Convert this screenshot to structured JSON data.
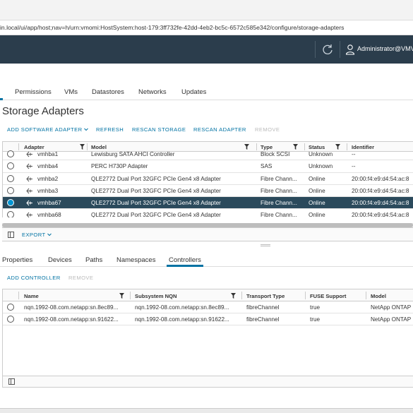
{
  "browser": {
    "url": "in.local/ui/app/host;nav=h/urn:vmomi:HostSystem:host-179:3ff732fe-42dd-4eb2-bc5c-6572c585e342/configure/storage-adapters"
  },
  "header": {
    "user": "Administrator@VMV"
  },
  "subnav": {
    "tabs": [
      "Permissions",
      "VMs",
      "Datastores",
      "Networks",
      "Updates"
    ]
  },
  "page": {
    "title": "Storage Adapters"
  },
  "toolbar": {
    "add_software_adapter": "ADD SOFTWARE ADAPTER",
    "refresh": "REFRESH",
    "rescan_storage": "RESCAN STORAGE",
    "rescan_adapter": "RESCAN ADAPTER",
    "remove": "REMOVE"
  },
  "adapters_grid": {
    "columns": [
      "Adapter",
      "Model",
      "Type",
      "Status",
      "Identifier"
    ],
    "rows": [
      {
        "adapter": "vmhba1",
        "model": "Lewisburg SATA AHCI Controller",
        "type": "Block SCSI",
        "status": "Unknown",
        "identifier": "--",
        "selected": false
      },
      {
        "adapter": "vmhba4",
        "model": "PERC H730P Adapter",
        "type": "SAS",
        "status": "Unknown",
        "identifier": "--",
        "selected": false
      },
      {
        "adapter": "vmhba2",
        "model": "QLE2772 Dual Port 32GFC PCIe Gen4 x8 Adapter",
        "type": "Fibre Chann...",
        "status": "Online",
        "identifier": "20:00:f4:e9:d4:54:ac:8",
        "selected": false
      },
      {
        "adapter": "vmhba3",
        "model": "QLE2772 Dual Port 32GFC PCIe Gen4 x8 Adapter",
        "type": "Fibre Chann...",
        "status": "Online",
        "identifier": "20:00:f4:e9:d4:54:ac:8",
        "selected": false
      },
      {
        "adapter": "vmhba67",
        "model": "QLE2772 Dual Port 32GFC PCIe Gen4 x8 Adapter",
        "type": "Fibre Chann...",
        "status": "Online",
        "identifier": "20:00:f4:e9:d4:54:ac:8",
        "selected": true
      },
      {
        "adapter": "vmhba68",
        "model": "QLE2772 Dual Port 32GFC PCIe Gen4 x8 Adapter",
        "type": "Fibre Chann...",
        "status": "Online",
        "identifier": "20:00:f4:e9:d4:54:ac:8",
        "selected": false
      }
    ],
    "export": "EXPORT"
  },
  "detail_tabs": [
    "Properties",
    "Devices",
    "Paths",
    "Namespaces",
    "Controllers"
  ],
  "detail_active_tab": "Controllers",
  "controllers_toolbar": {
    "add_controller": "ADD CONTROLLER",
    "remove": "REMOVE"
  },
  "controllers_grid": {
    "columns": [
      "Name",
      "Subsystem NQN",
      "Transport Type",
      "FUSE Support",
      "Model"
    ],
    "rows": [
      {
        "name": "nqn.1992-08.com.netapp:sn.8ec89...",
        "nqn": "nqn.1992-08.com.netapp:sn.8ec89...",
        "transport": "fibreChannel",
        "fuse": "true",
        "model": "NetApp ONTAP"
      },
      {
        "name": "nqn.1992-08.com.netapp:sn.91622...",
        "nqn": "nqn.1992-08.com.netapp:sn.91622...",
        "transport": "fibreChannel",
        "fuse": "true",
        "model": "NetApp ONTAP"
      }
    ]
  },
  "colors": {
    "header_bg": "#2b3d4c",
    "accent": "#0072a3",
    "selected_row": "#2b4a5c"
  }
}
